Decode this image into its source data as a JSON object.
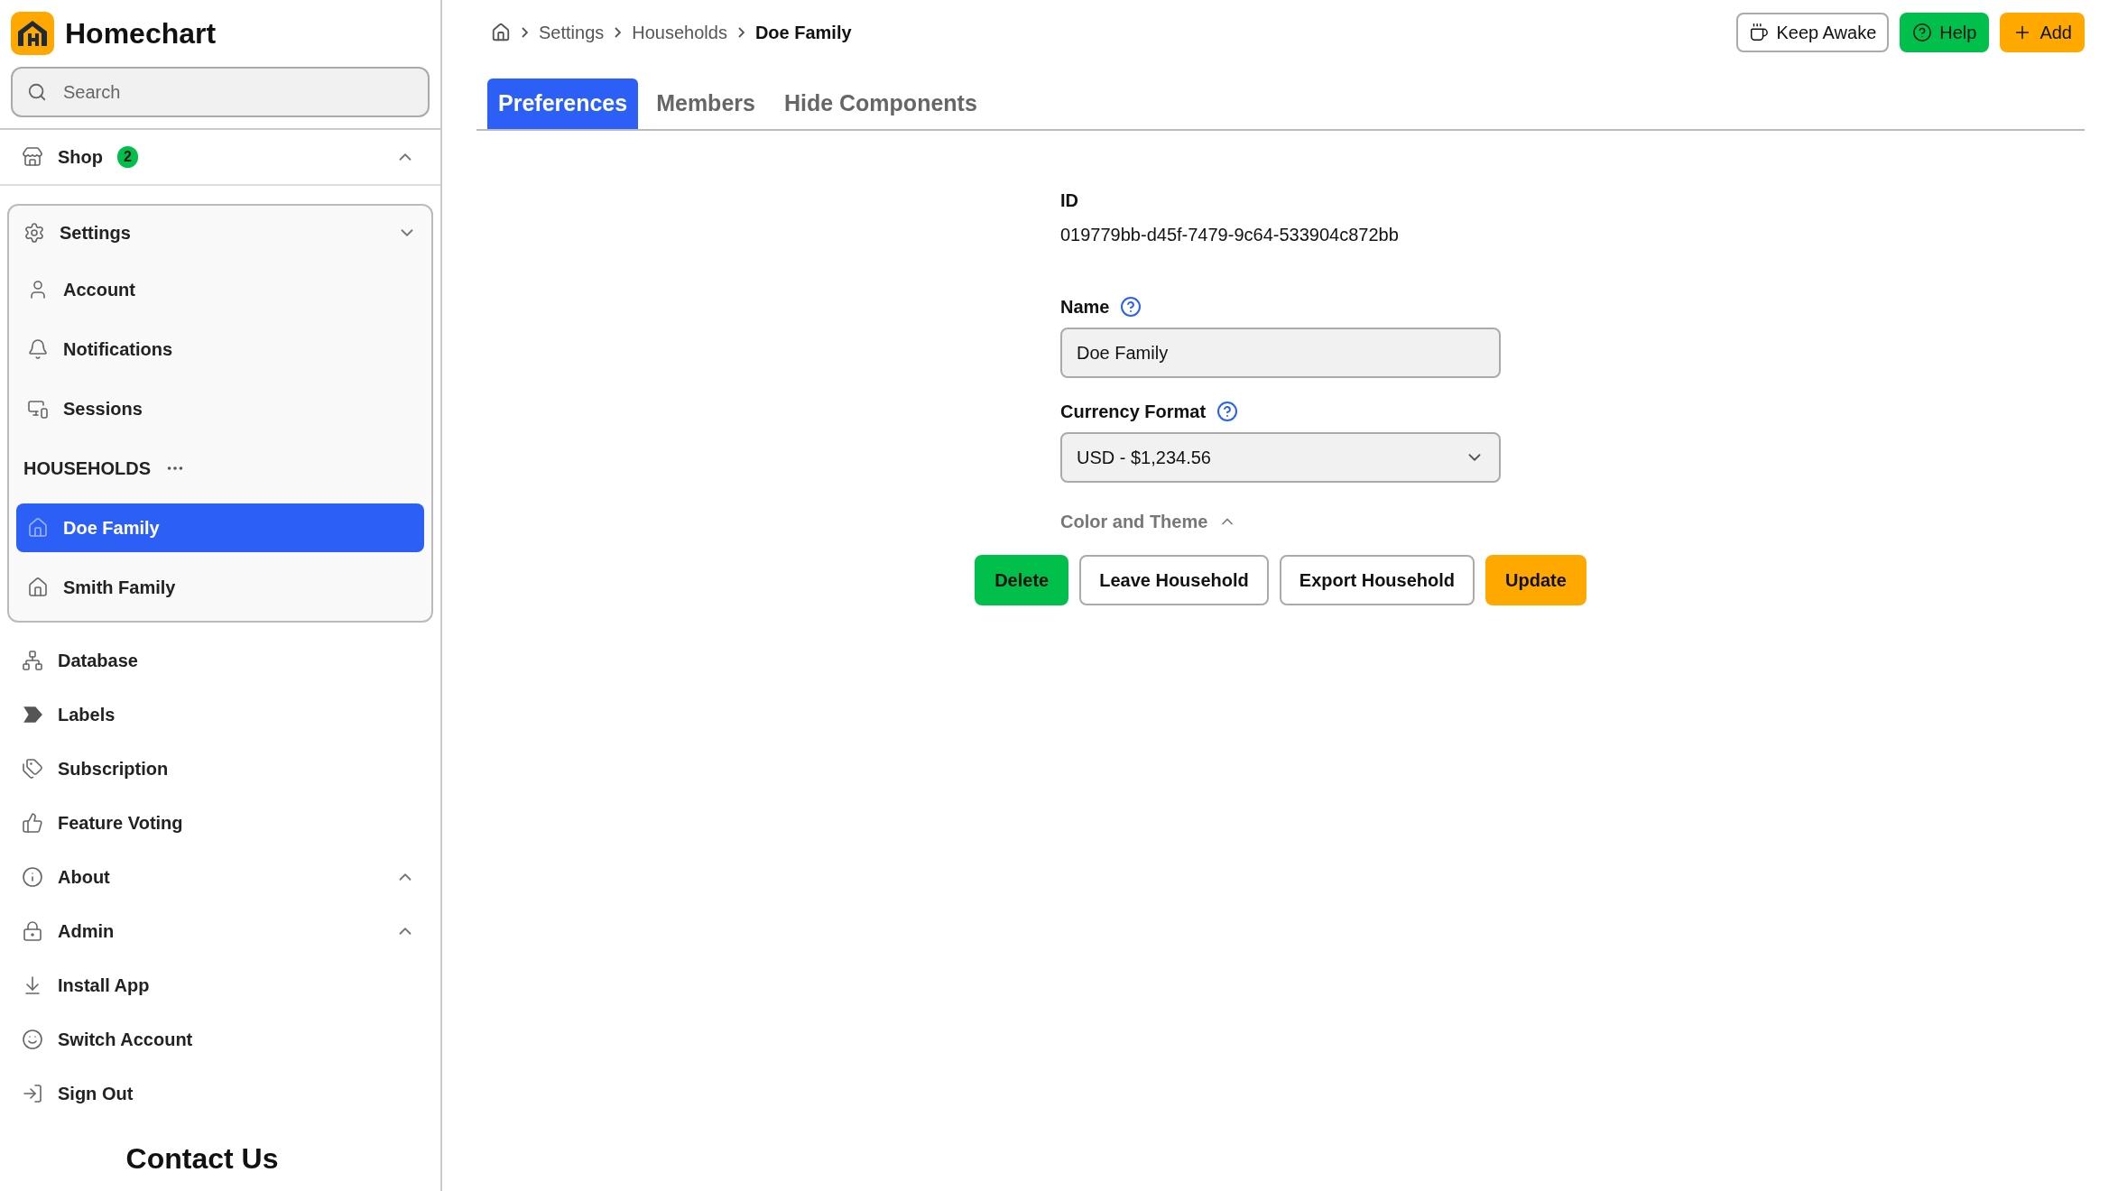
{
  "sidebar": {
    "app_name": "Homechart",
    "search": {
      "placeholder": "Search"
    },
    "nav": [
      {
        "kind": "group",
        "label": "Shop",
        "badge": "2",
        "expanded": false,
        "selected": false
      },
      {
        "kind": "group",
        "label": "Settings",
        "expanded": true,
        "selected": false,
        "children": [
          {
            "kind": "link",
            "label": "Account",
            "selected": false
          },
          {
            "kind": "link",
            "label": "Notifications",
            "selected": false
          },
          {
            "kind": "link",
            "label": "Sessions",
            "selected": false
          },
          {
            "kind": "header",
            "label": "HOUSEHOLDS"
          },
          {
            "kind": "household",
            "label": "Doe Family",
            "selected": true
          },
          {
            "kind": "household",
            "label": "Smith Family",
            "selected": false
          }
        ]
      },
      {
        "kind": "link",
        "label": "Database",
        "selected": false
      },
      {
        "kind": "link",
        "label": "Labels",
        "selected": false
      },
      {
        "kind": "link",
        "label": "Subscription",
        "selected": false
      },
      {
        "kind": "link",
        "label": "Feature Voting",
        "selected": false
      },
      {
        "kind": "group",
        "label": "About",
        "expanded": false,
        "selected": false
      },
      {
        "kind": "group",
        "label": "Admin",
        "expanded": false,
        "selected": false
      },
      {
        "kind": "link",
        "label": "Install App",
        "selected": false
      },
      {
        "kind": "link",
        "label": "Switch Account",
        "selected": false
      },
      {
        "kind": "link",
        "label": "Sign Out",
        "selected": false
      }
    ],
    "contact": "Contact Us"
  },
  "breadcrumbs": [
    {
      "label": "Settings",
      "current": false
    },
    {
      "label": "Households",
      "current": false
    },
    {
      "label": "Doe Family",
      "current": true
    }
  ],
  "header_buttons": [
    {
      "label": "Keep Awake",
      "kind": "outline"
    },
    {
      "label": "Help",
      "kind": "green"
    },
    {
      "label": "Add",
      "kind": "amber"
    }
  ],
  "tabs": [
    {
      "label": "Preferences",
      "selected": true
    },
    {
      "label": "Members",
      "selected": false
    },
    {
      "label": "Hide Components",
      "selected": false
    }
  ],
  "form": {
    "id_label": "ID",
    "id_value": "019779bb-d45f-7479-9c64-533904c872bb",
    "fields": [
      {
        "kind": "text",
        "label": "Name",
        "value": "Doe Family"
      },
      {
        "kind": "select",
        "label": "Currency Format",
        "value": "USD - $1,234.56"
      }
    ],
    "color_theme": {
      "label": "Color and Theme",
      "expanded": false
    },
    "actions": [
      {
        "label": "Delete",
        "kind": "green"
      },
      {
        "label": "Leave Household",
        "kind": "outline"
      },
      {
        "label": "Export Household",
        "kind": "outline"
      },
      {
        "label": "Update",
        "kind": "amber"
      }
    ]
  }
}
